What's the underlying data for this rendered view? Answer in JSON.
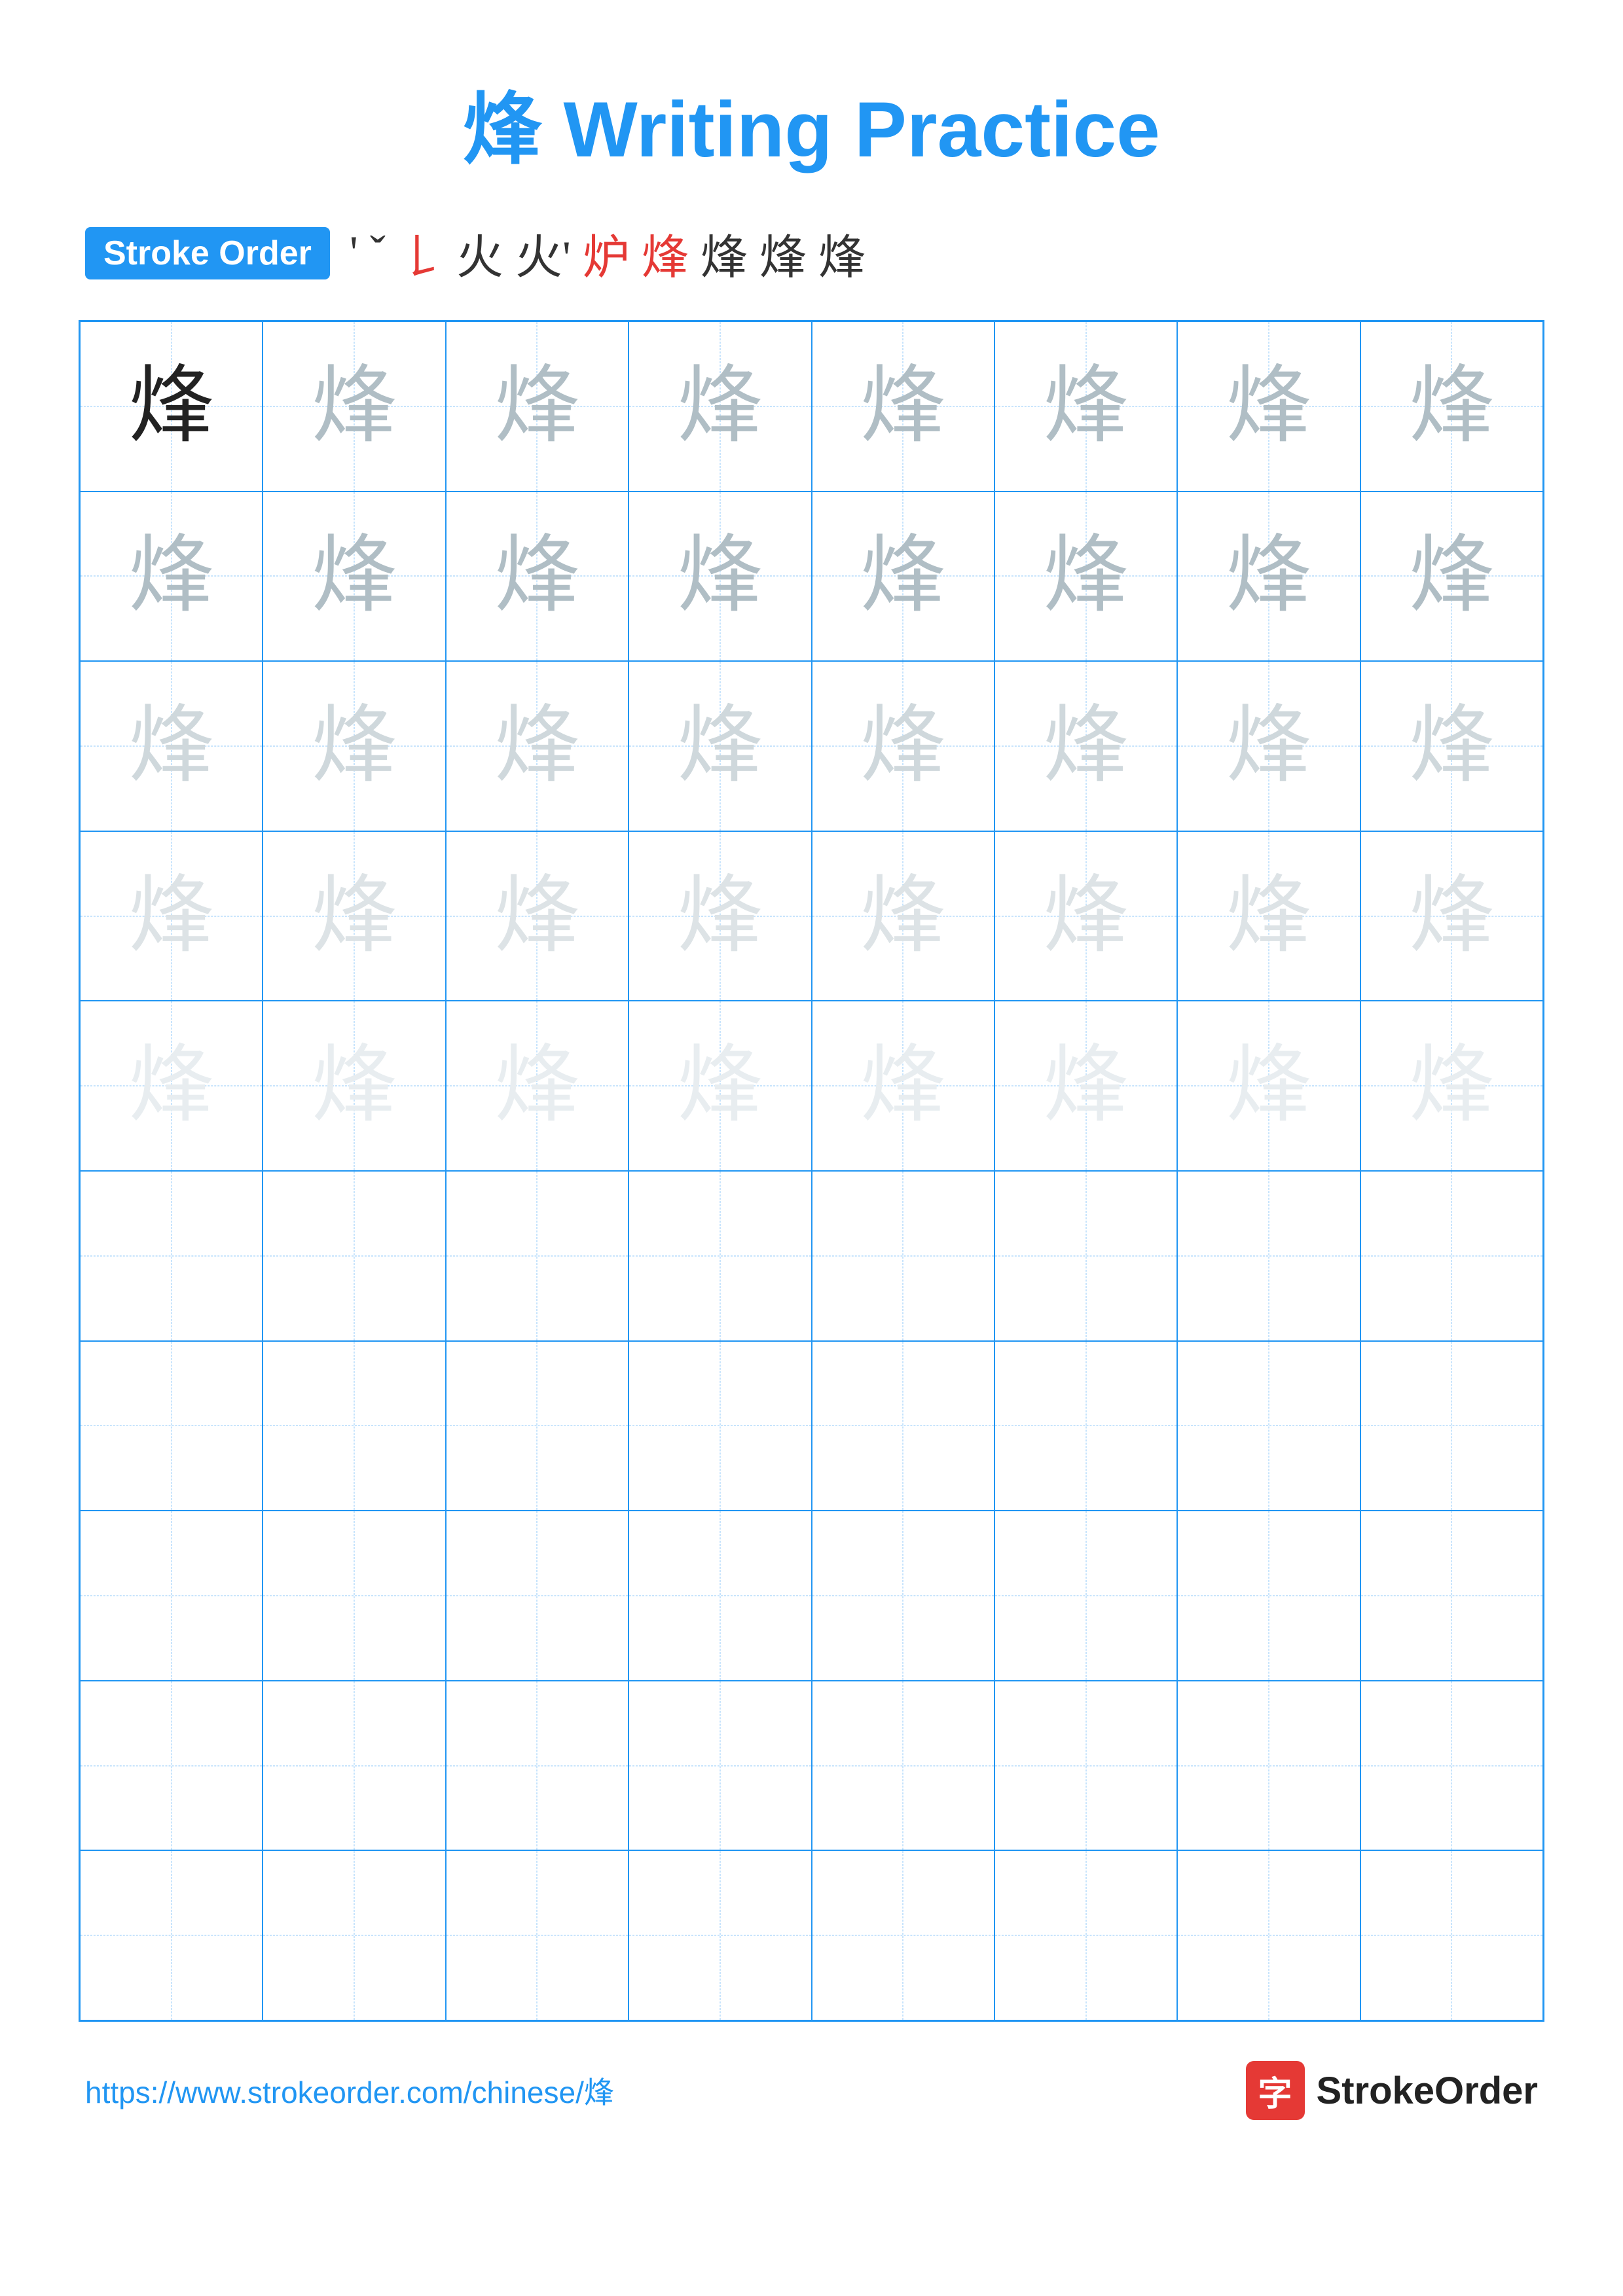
{
  "title": {
    "char": "烽",
    "label": "Writing Practice",
    "full": "烽 Writing Practice"
  },
  "stroke_order": {
    "badge_label": "Stroke Order",
    "strokes": [
      "丶",
      "𠃋",
      "乃",
      "火",
      "火",
      "炉",
      "烽",
      "烽",
      "烽",
      "烽"
    ],
    "stroke_display": [
      "'",
      "ˇ",
      "𠄌",
      "火",
      "火˙",
      "炉",
      "烽",
      "烽",
      "烽",
      "烽"
    ]
  },
  "grid": {
    "rows": 10,
    "cols": 8,
    "char": "烽",
    "practice_rows": 5,
    "empty_rows": 5
  },
  "footer": {
    "url": "https://www.strokeorder.com/chinese/烽",
    "brand_char": "字",
    "brand_name": "StrokeOrder"
  }
}
